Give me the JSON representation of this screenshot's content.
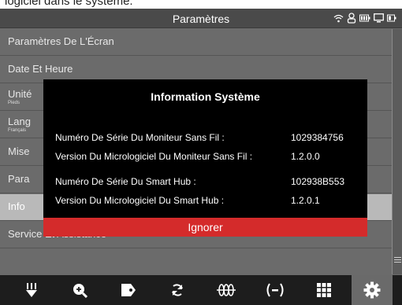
{
  "caption": "logiciel dans le système.",
  "header": {
    "title": "Paramètres"
  },
  "status_icons": [
    "wifi-icon",
    "person-icon",
    "battery-icon",
    "screen-icon",
    "battery-small-icon"
  ],
  "menu": {
    "items": [
      {
        "label": "Paramètres De L'Écran",
        "sub": ""
      },
      {
        "label": "Date Et Heure",
        "sub": ""
      },
      {
        "label": "Unité",
        "sub": "Pieds"
      },
      {
        "label": "Lang",
        "sub": "Français"
      },
      {
        "label": "Mise",
        "sub": ""
      },
      {
        "label": "Para",
        "sub": ""
      },
      {
        "label": "Info",
        "sub": "",
        "selected": true
      },
      {
        "label": "Service Et Assistance",
        "sub": ""
      }
    ]
  },
  "dialog": {
    "title": "Information Système",
    "rows": [
      {
        "label": "Numéro De Série Du Moniteur Sans Fil :",
        "value": "1029384756"
      },
      {
        "label": "Version Du Micrologiciel Du Moniteur Sans Fil :",
        "value": "1.2.0.0"
      },
      {
        "label": "Numéro De Série Du Smart Hub :",
        "value": "102938B553"
      },
      {
        "label": "Version Du Micrologiciel Du Smart Hub :",
        "value": "1.2.0.1"
      }
    ],
    "dismiss_label": "Ignorer"
  },
  "toolbar": {
    "items": [
      "probe-icon",
      "zoom-in-icon",
      "tag-icon",
      "rotate-icon",
      "sonar-icon",
      "broadcast-icon",
      "grid-icon",
      "settings-icon"
    ],
    "active": "settings-icon"
  },
  "colors": {
    "accent": "#d42b2b",
    "background": "#6b6b6b",
    "selected": "#b9b9b9"
  }
}
